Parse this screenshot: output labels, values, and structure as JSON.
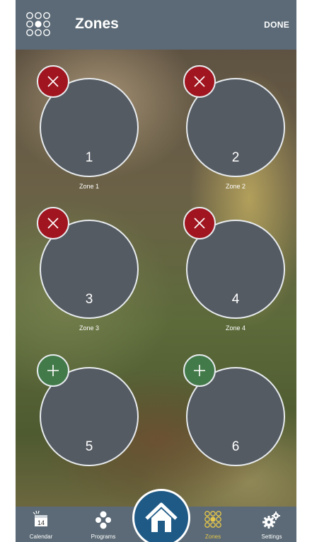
{
  "header": {
    "title": "Zones",
    "done_label": "DONE"
  },
  "zones": [
    {
      "number": "1",
      "name": "Zone 1",
      "action": "remove"
    },
    {
      "number": "2",
      "name": "Zone 2",
      "action": "remove"
    },
    {
      "number": "3",
      "name": "Zone 3",
      "action": "remove"
    },
    {
      "number": "4",
      "name": "Zone 4",
      "action": "remove"
    },
    {
      "number": "5",
      "name": "",
      "action": "add"
    },
    {
      "number": "6",
      "name": "",
      "action": "add"
    }
  ],
  "tabs": [
    {
      "label": "Calendar",
      "icon": "calendar-icon",
      "calendar_day": "14"
    },
    {
      "label": "Programs",
      "icon": "programs-icon"
    },
    {
      "label": "Zones",
      "icon": "zones-grid-icon",
      "active": true
    },
    {
      "label": "Settings",
      "icon": "gears-icon"
    }
  ],
  "home": {
    "icon": "home-icon"
  },
  "colors": {
    "bar": "#5b6a76",
    "remove": "#a0151f",
    "add": "#437a4a",
    "home": "#1f5a86",
    "active_tab": "#e6c64a"
  }
}
